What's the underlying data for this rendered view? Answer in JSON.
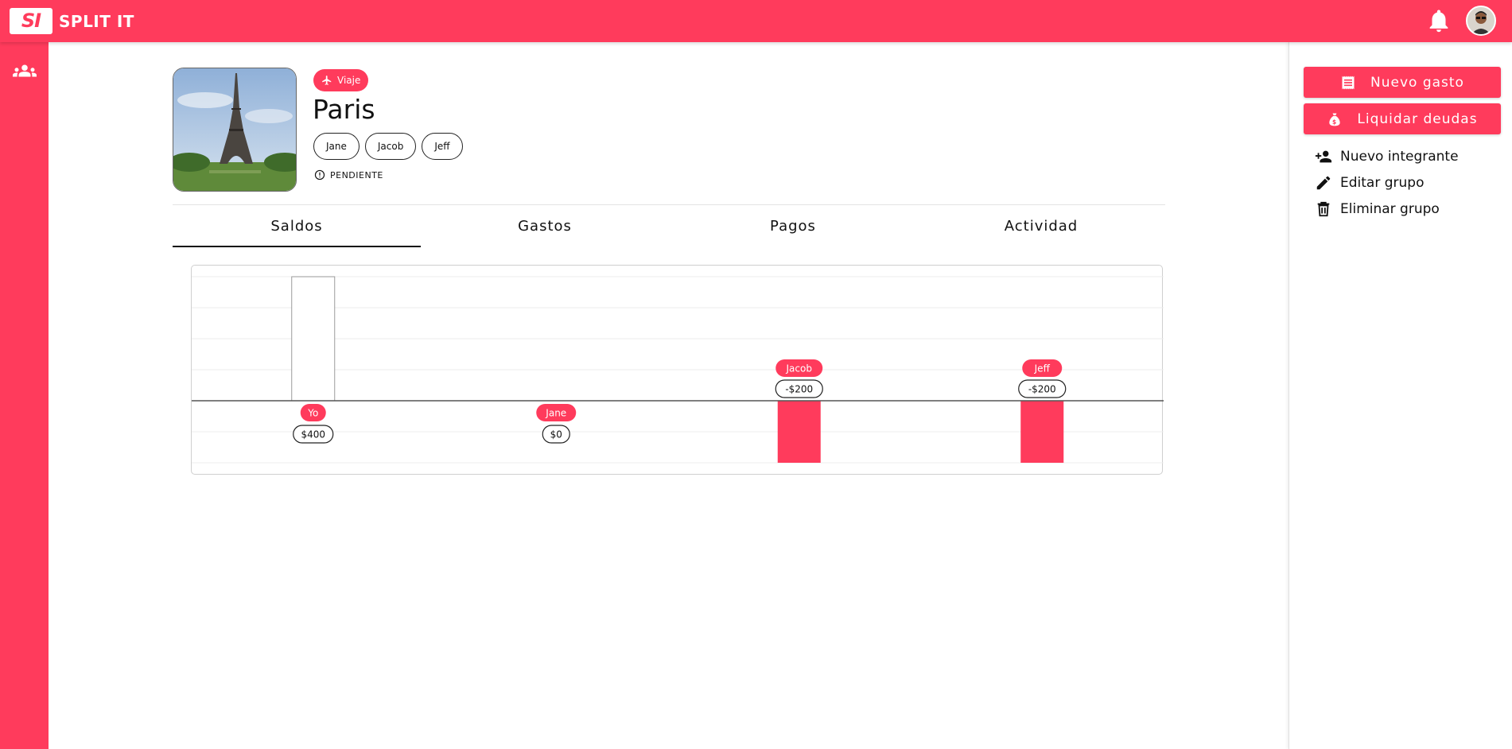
{
  "app": {
    "logo_mark": "SI",
    "logo_text": "SPLIT IT"
  },
  "header_icons": [
    "bell-icon",
    "avatar"
  ],
  "sidebar": {
    "items": [
      "group-icon"
    ]
  },
  "group": {
    "category": "Viaje",
    "title": "Paris",
    "members": [
      "Jane",
      "Jacob",
      "Jeff"
    ],
    "status": "PENDIENTE"
  },
  "tabs": [
    {
      "label": "Saldos",
      "active": true
    },
    {
      "label": "Gastos",
      "active": false
    },
    {
      "label": "Pagos",
      "active": false
    },
    {
      "label": "Actividad",
      "active": false
    }
  ],
  "colors": {
    "accent": "#ff3b5c",
    "text": "#111111"
  },
  "chart_data": {
    "type": "bar",
    "categories": [
      "Yo",
      "Jane",
      "Jacob",
      "Jeff"
    ],
    "values": [
      400,
      0,
      -200,
      -200
    ],
    "value_labels": [
      "$400",
      "$0",
      "-$200",
      "-$200"
    ],
    "ylim": [
      -200,
      400
    ],
    "grid": true,
    "positive_fill": "#ffffff",
    "negative_fill": "#ff3b5c"
  },
  "right_panel": {
    "buttons": [
      {
        "label": "Nuevo gasto",
        "icon": "receipt-icon"
      },
      {
        "label": "Liquidar deudas",
        "icon": "money-bag-icon"
      }
    ],
    "links": [
      {
        "label": "Nuevo integrante",
        "icon": "person-add-icon"
      },
      {
        "label": "Editar grupo",
        "icon": "pencil-icon"
      },
      {
        "label": "Eliminar grupo",
        "icon": "trash-icon"
      }
    ]
  }
}
